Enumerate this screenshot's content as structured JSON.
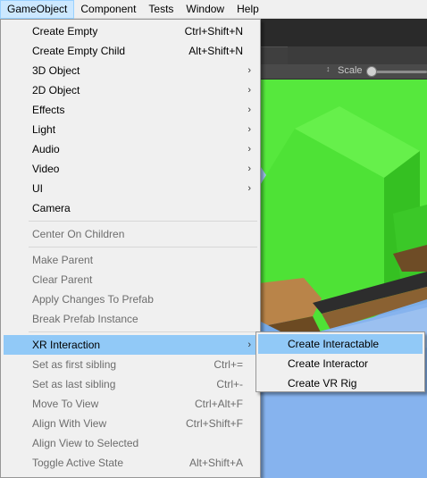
{
  "menubar": {
    "items": [
      "GameObject",
      "Component",
      "Tests",
      "Window",
      "Help"
    ]
  },
  "scene_toolbar": {
    "scale_label": "Scale",
    "scale_arrows": "↕"
  },
  "gameobject_menu": {
    "items": [
      {
        "label": "Create Empty",
        "shortcut": "Ctrl+Shift+N"
      },
      {
        "label": "Create Empty Child",
        "shortcut": "Alt+Shift+N"
      },
      {
        "label": "3D Object",
        "arrow": "›"
      },
      {
        "label": "2D Object",
        "arrow": "›"
      },
      {
        "label": "Effects",
        "arrow": "›"
      },
      {
        "label": "Light",
        "arrow": "›"
      },
      {
        "label": "Audio",
        "arrow": "›"
      },
      {
        "label": "Video",
        "arrow": "›"
      },
      {
        "label": "UI",
        "arrow": "›"
      },
      {
        "label": "Camera"
      },
      {
        "label": "Center On Children"
      },
      {
        "label": "Make Parent"
      },
      {
        "label": "Clear Parent"
      },
      {
        "label": "Apply Changes To Prefab"
      },
      {
        "label": "Break Prefab Instance"
      },
      {
        "label": "XR Interaction",
        "arrow": "›"
      },
      {
        "label": "Set as first sibling",
        "shortcut": "Ctrl+="
      },
      {
        "label": "Set as last sibling",
        "shortcut": "Ctrl+-"
      },
      {
        "label": "Move To View",
        "shortcut": "Ctrl+Alt+F"
      },
      {
        "label": "Align With View",
        "shortcut": "Ctrl+Shift+F"
      },
      {
        "label": "Align View to Selected"
      },
      {
        "label": "Toggle Active State",
        "shortcut": "Alt+Shift+A"
      }
    ]
  },
  "xr_submenu": {
    "items": [
      "Create Interactable",
      "Create Interactor",
      "Create VR Rig"
    ]
  },
  "colors": {
    "menu_bg": "#f0f0f0",
    "highlight": "#91c9f7",
    "disabled_text": "#6d6d6d",
    "scene_green": "#4fe33a",
    "scene_sky": "#7aa6e6"
  }
}
